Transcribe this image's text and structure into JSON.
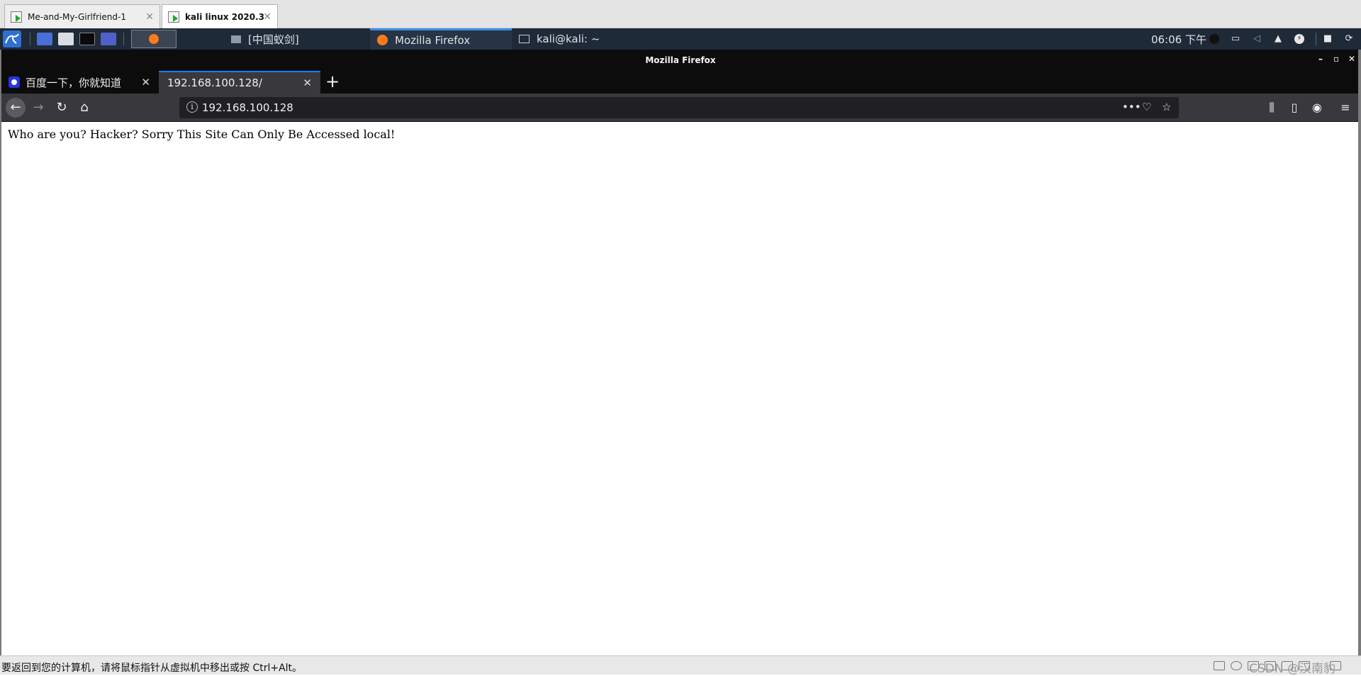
{
  "vm_tabs": [
    {
      "label": "Me-and-My-Girlfriend-1",
      "active": false
    },
    {
      "label": "kali linux 2020.3",
      "active": true
    }
  ],
  "panel": {
    "tasks": [
      {
        "label": "[中国蚁剑]"
      },
      {
        "label": "Mozilla Firefox"
      },
      {
        "label": "kali@kali: ~"
      }
    ],
    "clock": "06:06 下午"
  },
  "firefox": {
    "window_title": "Mozilla Firefox",
    "tabs": [
      {
        "label": "百度一下，你就知道",
        "selected": false
      },
      {
        "label": "192.168.100.128/",
        "selected": true
      }
    ],
    "url": "192.168.100.128",
    "page_message": "Who are you? Hacker? Sorry This Site Can Only Be Accessed local!"
  },
  "status_bar": {
    "hint": "要返回到您的计算机，请将鼠标指针从虚拟机中移出或按 Ctrl+Alt。",
    "watermark": "CSDN @汉南豹"
  },
  "colors": {
    "panel_bg": "#1f2a38",
    "firefox_chrome": "#38383d",
    "tab_accent": "#0a84ff",
    "task_accent": "#3b8de4"
  }
}
